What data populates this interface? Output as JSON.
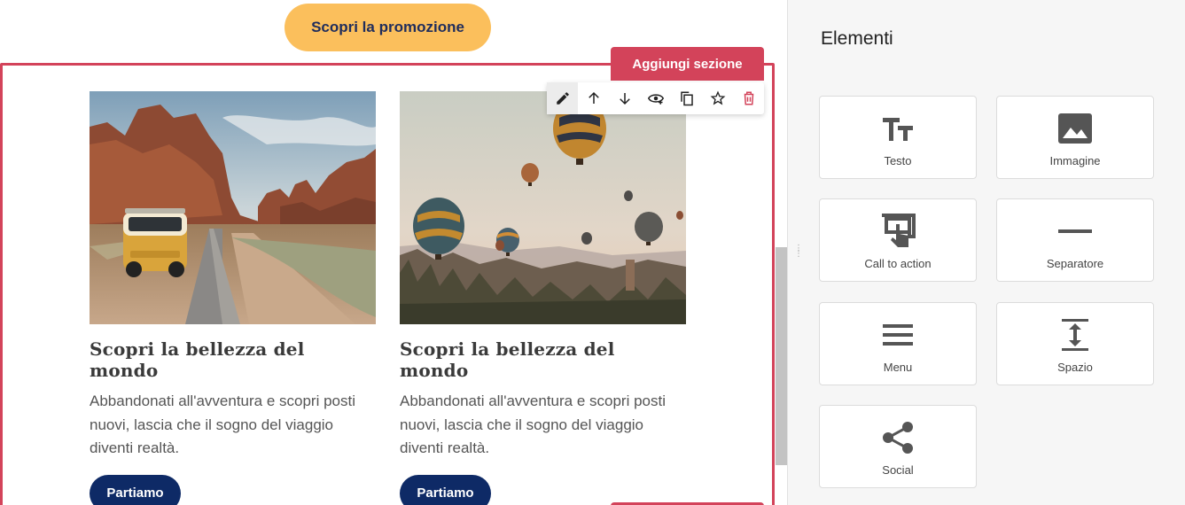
{
  "canvas": {
    "promo_button": "Scopri la promozione",
    "add_section": "Aggiungi sezione",
    "toolbar": [
      "edit-icon",
      "arrow-up-icon",
      "arrow-down-icon",
      "visibility-icon",
      "copy-icon",
      "star-icon",
      "delete-icon"
    ],
    "cards": [
      {
        "title": "Scopri la bellezza del mondo",
        "text": "Abbandonati all'avventura e scopri posti nuovi, lascia che il sogno del viaggio diventi realtà.",
        "button": "Partiamo",
        "image": "van-desert-road-photo"
      },
      {
        "title": "Scopri la bellezza del mondo",
        "text": "Abbandonati all'avventura e scopri posti nuovi, lascia che il sogno del viaggio diventi realtà.",
        "button": "Partiamo",
        "image": "hot-air-balloons-photo"
      }
    ]
  },
  "panel": {
    "title": "Elementi",
    "tiles": [
      {
        "label": "Testo",
        "icon": "text-icon"
      },
      {
        "label": "Immagine",
        "icon": "image-icon"
      },
      {
        "label": "Call to action",
        "icon": "call-to-action-icon"
      },
      {
        "label": "Separatore",
        "icon": "separator-icon"
      },
      {
        "label": "Menu",
        "icon": "menu-icon"
      },
      {
        "label": "Spazio",
        "icon": "spacing-icon"
      },
      {
        "label": "Social",
        "icon": "share-icon"
      }
    ]
  },
  "colors": {
    "accent": "#d3435a",
    "promo": "#fbbf5c",
    "navy": "#0e2a66",
    "icon": "#555555"
  }
}
